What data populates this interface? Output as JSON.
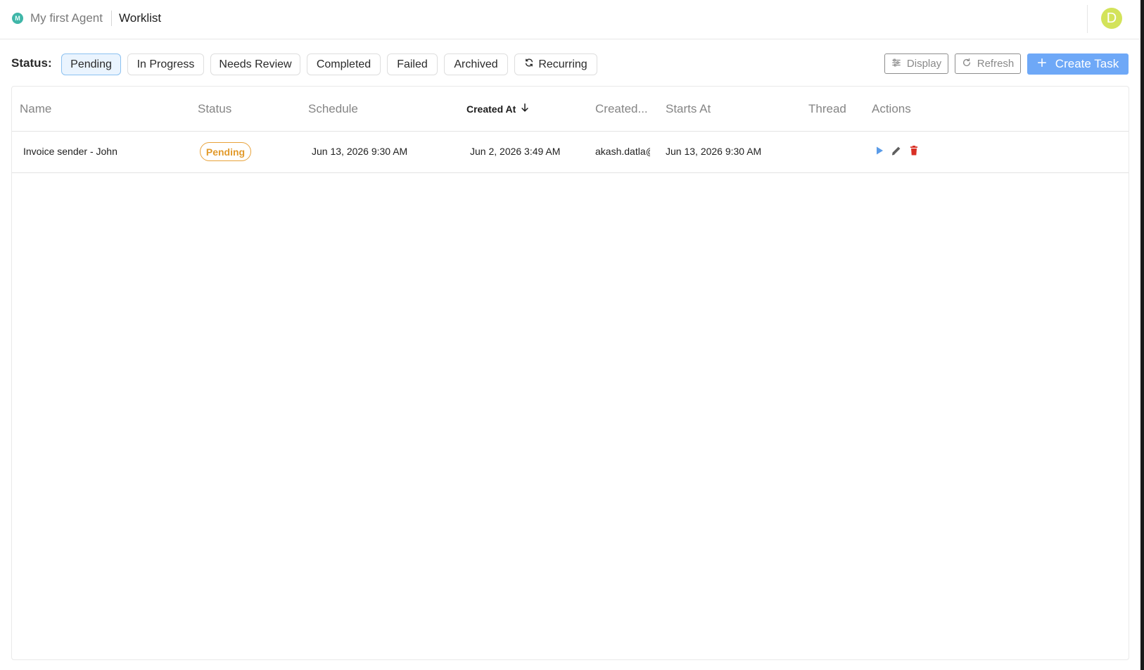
{
  "header": {
    "agent_initial": "M",
    "agent_name": "My first Agent",
    "page_title": "Worklist",
    "avatar_initial": "D"
  },
  "filters": {
    "label": "Status:",
    "chips": [
      {
        "label": "Pending",
        "active": true
      },
      {
        "label": "In Progress",
        "active": false
      },
      {
        "label": "Needs Review",
        "active": false
      },
      {
        "label": "Completed",
        "active": false
      },
      {
        "label": "Failed",
        "active": false
      },
      {
        "label": "Archived",
        "active": false
      },
      {
        "label": "Recurring",
        "active": false,
        "icon": "recurring-icon"
      }
    ]
  },
  "toolbar": {
    "display_label": "Display",
    "refresh_label": "Refresh",
    "create_label": "Create Task"
  },
  "table": {
    "columns": [
      "Name",
      "Status",
      "Schedule",
      "Created At",
      "Created...",
      "Starts At",
      "Thread",
      "Actions"
    ],
    "sorted_column": "Created At",
    "sort_direction": "desc",
    "rows": [
      {
        "name": "Invoice sender - John",
        "status": "Pending",
        "schedule": "Jun 13, 2026 9:30 AM",
        "created_at": "Jun 2, 2026 3:49 AM",
        "created_by": "akash.datla@",
        "starts_at": "Jun 13, 2026 9:30 AM",
        "thread": "",
        "actions": [
          "play-icon",
          "edit-icon",
          "delete-icon"
        ]
      }
    ]
  },
  "colors": {
    "accent": "#6ea8f7",
    "pending": "#e29a2b",
    "delete": "#d93025",
    "agent_dot": "#3fb6a8",
    "avatar": "#d3e35a"
  }
}
